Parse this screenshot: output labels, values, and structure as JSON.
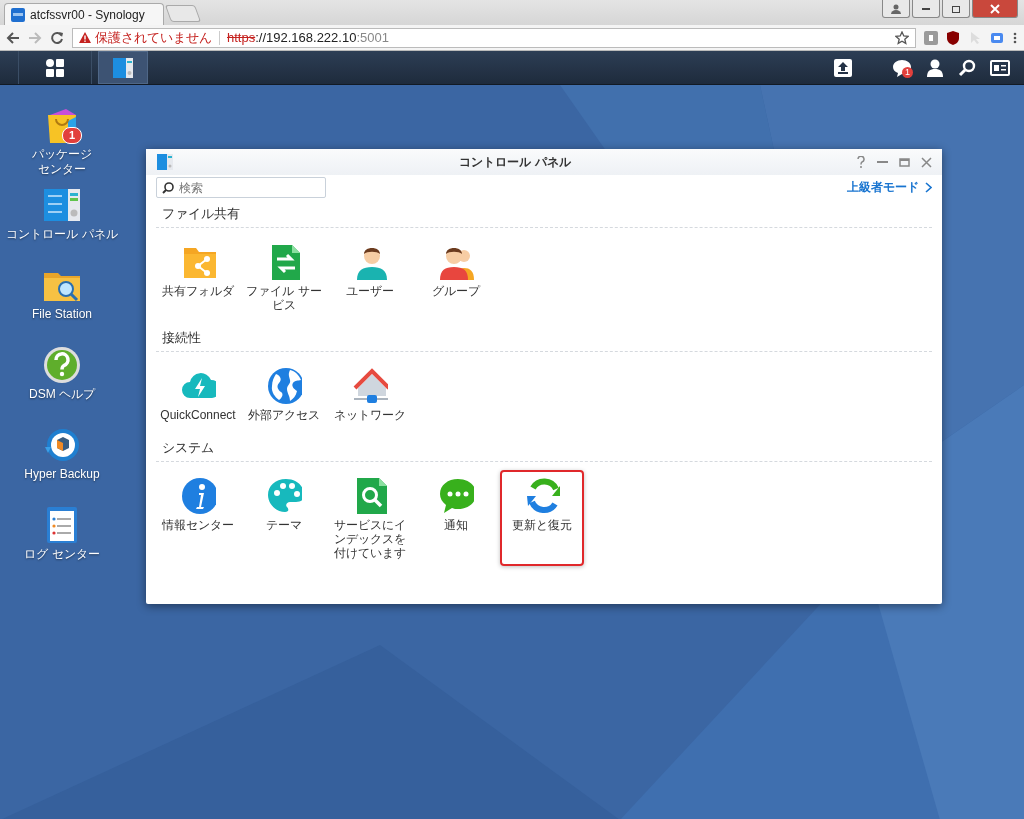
{
  "browser": {
    "tab": {
      "title": "atcfssvr00 - Synology"
    },
    "address": {
      "warning": "保護されていません",
      "scheme": "https",
      "host": "://192.168.222.10",
      "port": ":5001"
    }
  },
  "taskbar": {
    "notification_badge": "1"
  },
  "desktop_icons": [
    {
      "label_lines": [
        "パッケージ",
        "センター"
      ],
      "badge": "1"
    },
    {
      "label_lines": [
        "コントロール パネル"
      ]
    },
    {
      "label_lines": [
        "File Station"
      ]
    },
    {
      "label_lines": [
        "DSM ヘルプ"
      ]
    },
    {
      "label_lines": [
        "Hyper Backup"
      ]
    },
    {
      "label_lines": [
        "ログ センター"
      ]
    }
  ],
  "window": {
    "title": "コントロール パネル",
    "search": {
      "placeholder": "検索"
    },
    "advanced_link": "上級者モード",
    "sections": [
      {
        "title": "ファイル共有",
        "items": [
          {
            "label": "共有フォルダ",
            "selected": false
          },
          {
            "label": "ファイル サービス",
            "selected": false
          },
          {
            "label": "ユーザー",
            "selected": false
          },
          {
            "label": "グループ",
            "selected": false
          }
        ]
      },
      {
        "title": "接続性",
        "items": [
          {
            "label": "QuickConnect",
            "selected": false
          },
          {
            "label": "外部アクセス",
            "selected": false
          },
          {
            "label": "ネットワーク",
            "selected": false
          }
        ]
      },
      {
        "title": "システム",
        "items": [
          {
            "label": "情報センター",
            "selected": false
          },
          {
            "label": "テーマ",
            "selected": false
          },
          {
            "label": "サービスにインデックスを付けています",
            "selected": false
          },
          {
            "label": "通知",
            "selected": false
          },
          {
            "label": "更新と復元",
            "selected": true
          }
        ]
      }
    ]
  }
}
